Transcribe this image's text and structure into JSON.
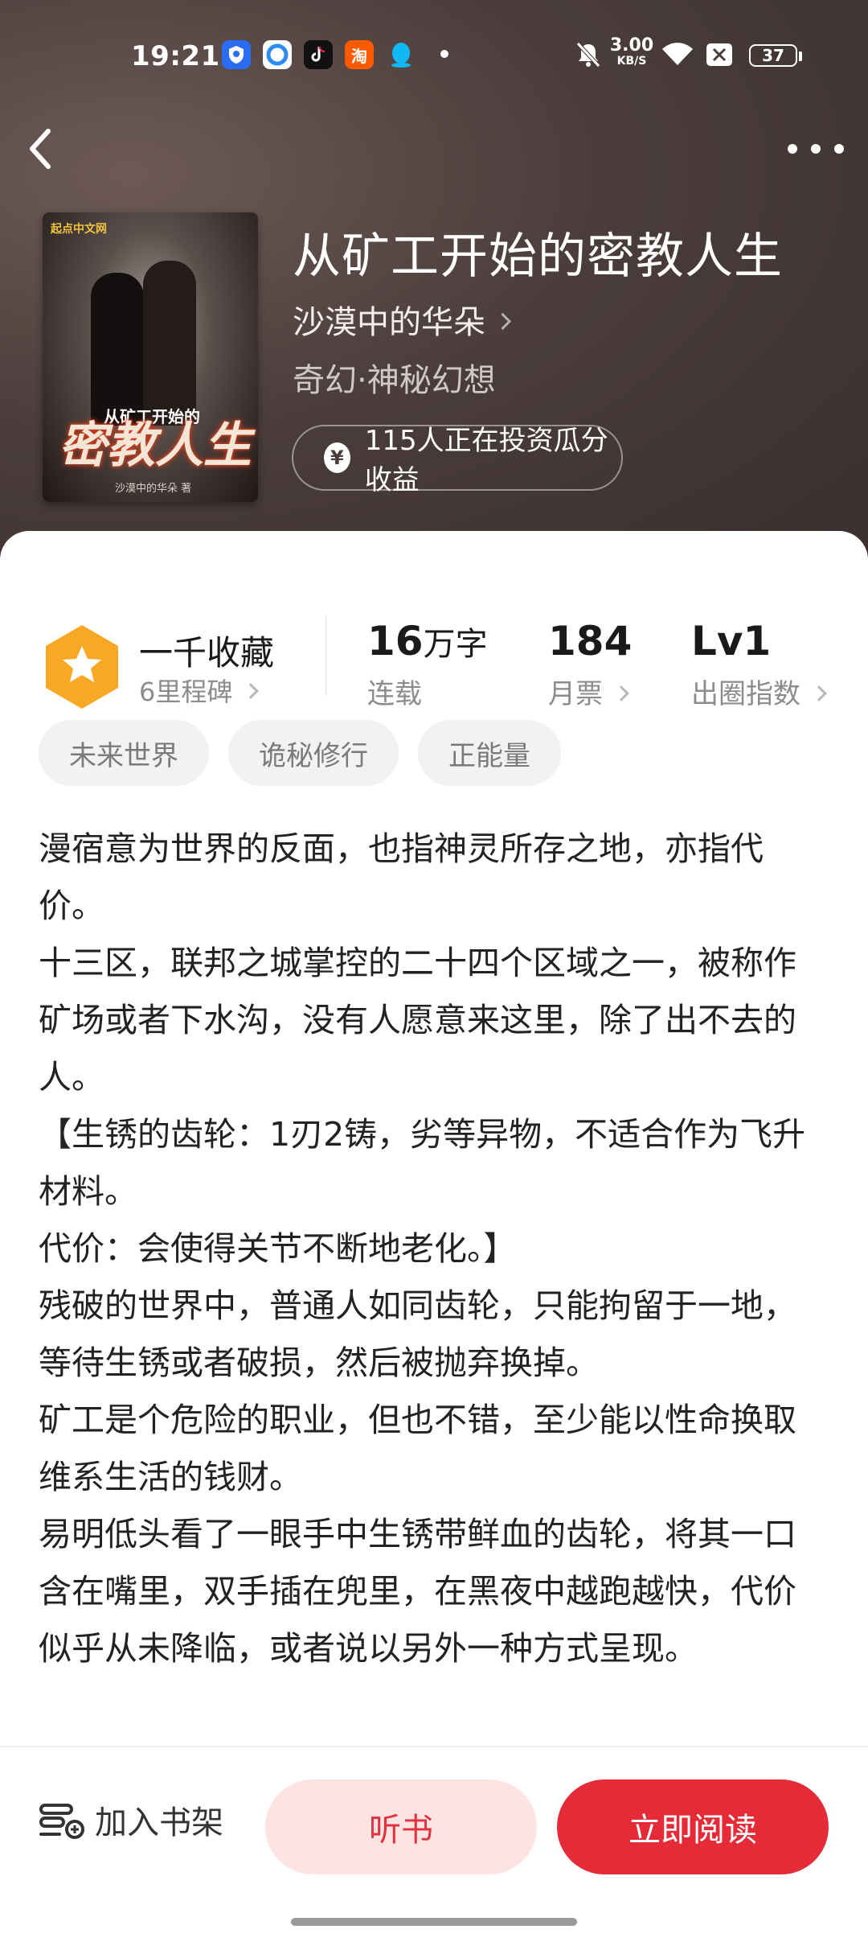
{
  "status_bar": {
    "time": "19:21",
    "net_speed": "3.00",
    "net_unit": "KB/S",
    "battery": "37",
    "apps": [
      {
        "icon": "shield-location-icon",
        "color": "#2a6df4"
      },
      {
        "icon": "browser-icon",
        "color": "#2e8cf0"
      },
      {
        "icon": "tiktok-icon",
        "color": "#111111"
      },
      {
        "icon": "taobao-icon",
        "color": "#ff5a00",
        "label": "淘"
      },
      {
        "icon": "qq-icon",
        "color": "#12b7f5"
      }
    ]
  },
  "book": {
    "title": "从矿工开始的密教人生",
    "author": "沙漠中的华朵",
    "genre": "奇幻·神秘幻想",
    "invest_text": "115人正在投资瓜分收益",
    "cover": {
      "publisher": "起点中文网",
      "title": "密教人生",
      "subtitle": "从矿工开始的",
      "author_line": "沙漠中的华朵 著"
    }
  },
  "stats": {
    "collection_title": "一千收藏",
    "collection_sub": "6里程碑",
    "words_num": "16",
    "words_unit": "万字",
    "words_sub": "连载",
    "monthly_num": "184",
    "monthly_sub": "月票",
    "level_num": "Lv1",
    "level_sub": "出圈指数"
  },
  "tags": [
    "未来世界",
    "诡秘修行",
    "正能量"
  ],
  "description": [
    "漫宿意为世界的反面，也指神灵所存之地，亦指代价。",
    "十三区，联邦之城掌控的二十四个区域之一，被称作矿场或者下水沟，没有人愿意来这里，除了出不去的人。",
    "【生锈的齿轮：1刃2铸，劣等异物，不适合作为飞升材料。",
    "代价：会使得关节不断地老化。】",
    "残破的世界中，普通人如同齿轮，只能拘留于一地，等待生锈或者破损，然后被抛弃换掉。",
    "矿工是个危险的职业，但也不错，至少能以性命换取维系生活的钱财。",
    "易明低头看了一眼手中生锈带鲜血的齿轮，将其一口含在嘴里，双手插在兜里，在黑夜中越跑越快，代价似乎从未降临，或者说以另外一种方式呈现。"
  ],
  "actions": {
    "shelf": "加入书架",
    "listen": "听书",
    "read": "立即阅读"
  }
}
